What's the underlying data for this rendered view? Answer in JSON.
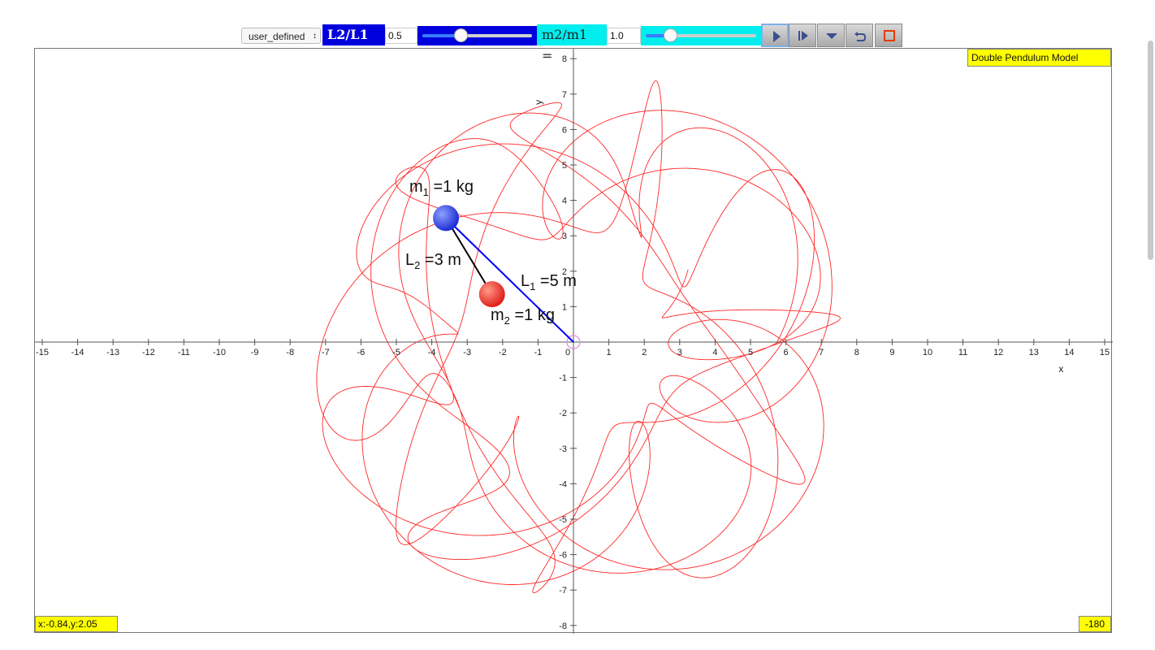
{
  "toolbar": {
    "preset": "user_defined",
    "ratio_l_label": "L2/L1 =",
    "ratio_l_value": "0.5",
    "ratio_l_slider_fraction": 0.36,
    "ratio_m_label": "m2/m1 =",
    "ratio_m_value": "1.0",
    "ratio_m_slider_fraction": 0.24,
    "buttons": [
      "play-icon",
      "step-icon",
      "menu-down-icon",
      "reset-icon",
      "stop-icon"
    ]
  },
  "plot": {
    "title": "Double Pendulum Model",
    "coord_readout": "x:-0.84,y:2.05",
    "angle_readout": "-180",
    "x_axis_label": "x",
    "y_axis_label": "y",
    "x_ticks": [
      "-15",
      "-14",
      "-13",
      "-12",
      "-11",
      "-10",
      "-9",
      "-8",
      "-7",
      "-6",
      "-5",
      "-4",
      "-3",
      "-2",
      "-1",
      "0",
      "1",
      "2",
      "3",
      "4",
      "5",
      "6",
      "7",
      "8",
      "9",
      "10",
      "11",
      "12",
      "13",
      "14",
      "15"
    ],
    "y_ticks": [
      "-8",
      "-7",
      "-6",
      "-5",
      "-4",
      "-3",
      "-2",
      "-1",
      "0",
      "1",
      "2",
      "3",
      "4",
      "5",
      "6",
      "7",
      "8"
    ],
    "mass1": {
      "name": "m",
      "sub": "1",
      "text": " =1 kg",
      "x": -3.6,
      "y": 3.5
    },
    "mass2": {
      "name": "m",
      "sub": "2",
      "text": " =1 kg",
      "x": -2.3,
      "y": 1.35
    },
    "rod1": {
      "name": "L",
      "sub": "1",
      "text": " =5 m"
    },
    "rod2": {
      "name": "L",
      "sub": "2",
      "text": " =3 m"
    },
    "colors": {
      "trace": "#ff0000",
      "rod1": "#0000ff",
      "rod2": "#000000",
      "mass1": "#1f2fd6",
      "mass2": "#e0201a",
      "label_bg": "#ffff00"
    }
  }
}
